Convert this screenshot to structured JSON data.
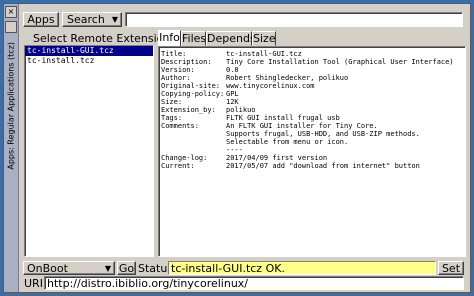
{
  "sidebar": {
    "title": "Apps: Regular Applications (tcz)"
  },
  "toolbar": {
    "apps_label": "Apps",
    "search_label": "Search",
    "search_value": ""
  },
  "list_title": "Select Remote Extension",
  "extensions": [
    "tc-install-GUI.tcz",
    "tc-install.tcz"
  ],
  "tabs": [
    "Info",
    "Files",
    "Depends",
    "Size"
  ],
  "info_rows": [
    {
      "k": "Title:",
      "v": "tc-install-GUI.tcz"
    },
    {
      "k": "Description:",
      "v": "Tiny Core Installation Tool (Graphical User Interface)"
    },
    {
      "k": "Version:",
      "v": "0.8"
    },
    {
      "k": "Author:",
      "v": "Robert Shingledecker, polikuo"
    },
    {
      "k": "Original-site:",
      "v": "www.tinycorelinux.com"
    },
    {
      "k": "Copying-policy:",
      "v": "GPL"
    },
    {
      "k": "Size:",
      "v": "12K"
    },
    {
      "k": "Extension_by:",
      "v": "polikuo"
    },
    {
      "k": "Tags:",
      "v": "FLTK GUI install frugal usb"
    },
    {
      "k": "Comments:",
      "v": "An FLTK GUI installer for Tiny Core."
    },
    {
      "k": "",
      "v": "Supports frugal, USB-HDD, and USB-ZIP methods."
    },
    {
      "k": "",
      "v": "Selectable from menu or icon."
    },
    {
      "k": "",
      "v": "----"
    },
    {
      "k": "Change-log:",
      "v": "2017/04/09 first version"
    },
    {
      "k": "Current:",
      "v": "2017/05/07 add \"download from internet\" button"
    }
  ],
  "bottom": {
    "onboot_value": "OnBoot",
    "go_label": "Go",
    "status_label": "Status",
    "status_value": "tc-install-GUI.tcz OK.",
    "set_label": "Set",
    "uri_label": "URI:",
    "uri_value": "http://distro.ibiblio.org/tinycorelinux/"
  },
  "colors": {
    "status_bg": "#ffff88",
    "selection": "#00008b",
    "sidebar": "#aab0c4"
  }
}
